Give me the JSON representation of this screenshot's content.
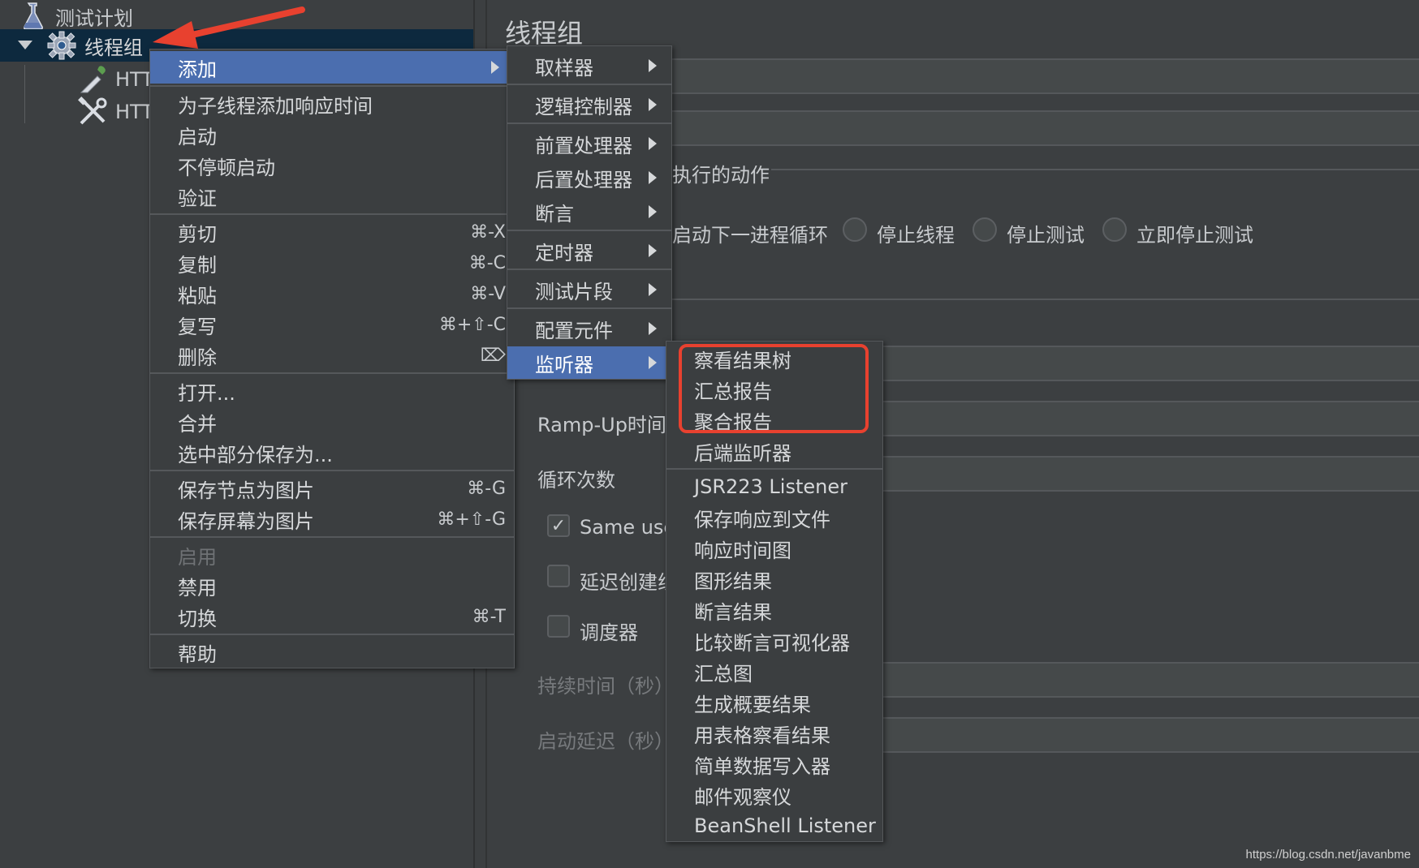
{
  "tree": {
    "items": [
      {
        "label": "测试计划",
        "icon": "flask-icon"
      },
      {
        "label": "线程组",
        "icon": "gear-icon"
      },
      {
        "label": "HTT",
        "icon": "pipette-icon"
      },
      {
        "label": "HTT",
        "icon": "tools-icon"
      }
    ]
  },
  "editor": {
    "title": "线程组",
    "action_label": "执行的动作",
    "radio_options": [
      "启动下一进程循环",
      "停止线程",
      "停止测试",
      "立即停止测试"
    ],
    "rampup_label": "Ramp-Up时间",
    "loop_label": "循环次数",
    "same_user_label": "Same use",
    "delay_create_label": "延迟创建线",
    "scheduler_label": "调度器",
    "duration_label": "持续时间（秒）",
    "startup_delay_label": "启动延迟（秒）"
  },
  "context_menu": {
    "items": [
      {
        "label": "添加",
        "submenu": true,
        "active": true
      },
      {
        "label": "为子线程添加响应时间"
      },
      {
        "label": "启动"
      },
      {
        "label": "不停顿启动"
      },
      {
        "label": "验证"
      },
      {
        "label": "剪切",
        "shortcut": "⌘-X"
      },
      {
        "label": "复制",
        "shortcut": "⌘-C"
      },
      {
        "label": "粘贴",
        "shortcut": "⌘-V"
      },
      {
        "label": "复写",
        "shortcut": "⌘+⇧-C"
      },
      {
        "label": "删除",
        "shortcut": "⌦"
      },
      {
        "label": "打开..."
      },
      {
        "label": "合并"
      },
      {
        "label": "选中部分保存为..."
      },
      {
        "label": "保存节点为图片",
        "shortcut": "⌘-G"
      },
      {
        "label": "保存屏幕为图片",
        "shortcut": "⌘+⇧-G"
      },
      {
        "label": "启用",
        "disabled": true
      },
      {
        "label": "禁用"
      },
      {
        "label": "切换",
        "shortcut": "⌘-T"
      },
      {
        "label": "帮助"
      }
    ]
  },
  "add_submenu": {
    "items": [
      {
        "label": "取样器"
      },
      {
        "label": "逻辑控制器"
      },
      {
        "label": "前置处理器"
      },
      {
        "label": "后置处理器"
      },
      {
        "label": "断言"
      },
      {
        "label": "定时器"
      },
      {
        "label": "测试片段"
      },
      {
        "label": "配置元件"
      },
      {
        "label": "监听器",
        "active": true
      }
    ]
  },
  "listener_submenu": {
    "items": [
      "察看结果树",
      "汇总报告",
      "聚合报告",
      "后端监听器",
      "JSR223 Listener",
      "保存响应到文件",
      "响应时间图",
      "图形结果",
      "断言结果",
      "比较断言可视化器",
      "汇总图",
      "生成概要结果",
      "用表格察看结果",
      "简单数据写入器",
      "邮件观察仪",
      "BeanShell Listener"
    ]
  },
  "colors": {
    "background": "#3c3f41",
    "menu_active": "#4b6eaf",
    "tree_selected": "#0d293e",
    "highlight": "#e8412f"
  },
  "watermark": "https://blog.csdn.net/javanbme"
}
